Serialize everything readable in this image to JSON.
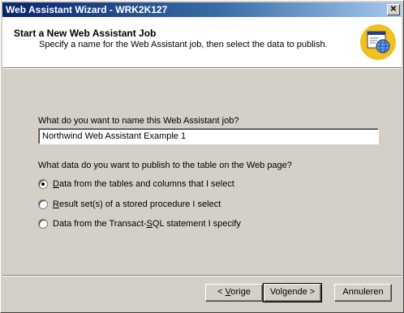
{
  "window": {
    "title": "Web Assistant Wizard - WRK2K127",
    "close_glyph": "✕"
  },
  "header": {
    "title": "Start a New Web Assistant Job",
    "subtitle": "Specify a name for the Web Assistant job, then select the data to publish.",
    "icon": "web-page-globe-icon"
  },
  "form": {
    "name_question": "What do you want to name this Web Assistant job?",
    "name_value": "Northwind Web Assistant Example 1",
    "data_question": "What data do you want to publish to the table on the Web page?",
    "options": [
      {
        "pre": "",
        "accel": "D",
        "post": "ata from the tables and columns that I select",
        "selected": true
      },
      {
        "pre": "",
        "accel": "R",
        "post": "esult set(s) of a stored procedure I select",
        "selected": false
      },
      {
        "pre": "Data from the Transact-",
        "accel": "S",
        "post": "QL statement I specify",
        "selected": false
      }
    ]
  },
  "buttons": {
    "back_pre": "< ",
    "back_accel": "V",
    "back_post": "orige",
    "next_label": "Volgende >",
    "cancel_label": "Annuleren"
  },
  "colors": {
    "title_gradient_start": "#0a246a",
    "title_gradient_end": "#a6caf0",
    "dialog_face": "#d4d0c8",
    "icon_circle": "#f0c020"
  }
}
